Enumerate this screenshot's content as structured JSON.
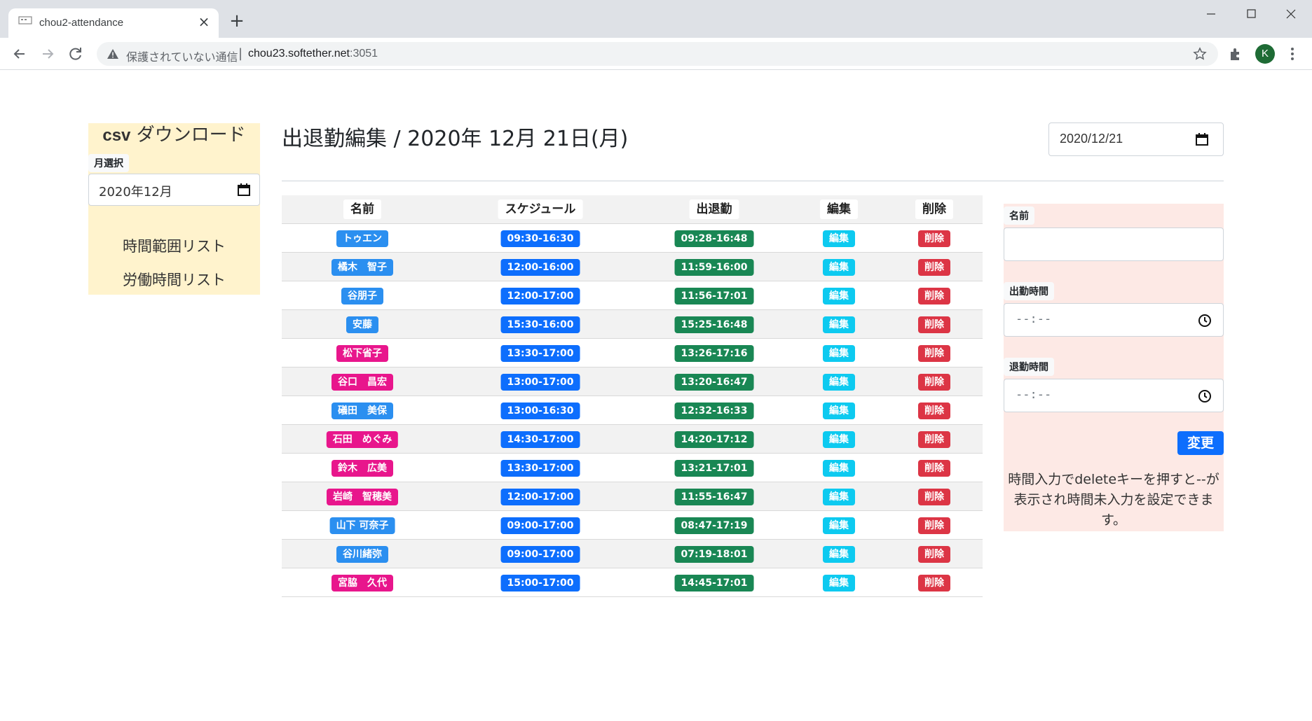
{
  "browser": {
    "tab_title": "chou2-attendance",
    "security_text": "保護されていない通信",
    "url_host": "chou23.softether.net",
    "url_port": ":3051",
    "profile_initial": "K"
  },
  "sidebar": {
    "csv_prefix": "csv",
    "csv_suffix": " ダウンロード",
    "month_label": "月選択",
    "month_value": "2020年12月",
    "links": [
      "時間範囲リスト",
      "労働時間リスト"
    ]
  },
  "main": {
    "title": "出退勤編集 / 2020年 12月 21日(月)",
    "date_value": "2020/12/21"
  },
  "table": {
    "headers": [
      "名前",
      "スケジュール",
      "出退勤",
      "編集",
      "削除"
    ],
    "edit_label": "編集",
    "delete_label": "削除",
    "rows": [
      {
        "name": "トゥエン",
        "gender": "m",
        "schedule": "09:30-16:30",
        "attendance": "09:28-16:48"
      },
      {
        "name": "橘木　智子",
        "gender": "m",
        "schedule": "12:00-16:00",
        "attendance": "11:59-16:00"
      },
      {
        "name": "谷朋子",
        "gender": "m",
        "schedule": "12:00-17:00",
        "attendance": "11:56-17:01"
      },
      {
        "name": "安藤",
        "gender": "m",
        "schedule": "15:30-16:00",
        "attendance": "15:25-16:48"
      },
      {
        "name": "松下省子",
        "gender": "f",
        "schedule": "13:30-17:00",
        "attendance": "13:26-17:16"
      },
      {
        "name": "谷口　昌宏",
        "gender": "f",
        "schedule": "13:00-17:00",
        "attendance": "13:20-16:47"
      },
      {
        "name": "礒田　美保",
        "gender": "m",
        "schedule": "13:00-16:30",
        "attendance": "12:32-16:33"
      },
      {
        "name": "石田　めぐみ",
        "gender": "f",
        "schedule": "14:30-17:00",
        "attendance": "14:20-17:12"
      },
      {
        "name": "鈴木　広美",
        "gender": "f",
        "schedule": "13:30-17:00",
        "attendance": "13:21-17:01"
      },
      {
        "name": "岩崎　智穂美",
        "gender": "f",
        "schedule": "12:00-17:00",
        "attendance": "11:55-16:47"
      },
      {
        "name": "山下 可奈子",
        "gender": "m",
        "schedule": "09:00-17:00",
        "attendance": "08:47-17:19"
      },
      {
        "name": "谷川緒弥",
        "gender": "m",
        "schedule": "09:00-17:00",
        "attendance": "07:19-18:01"
      },
      {
        "name": "宮脇　久代",
        "gender": "f",
        "schedule": "15:00-17:00",
        "attendance": "14:45-17:01"
      }
    ]
  },
  "form": {
    "name_label": "名前",
    "name_value": "",
    "start_label": "出勤時間",
    "start_value": "--:--",
    "end_label": "退勤時間",
    "end_value": "--:--",
    "submit_label": "変更",
    "help_text": "時間入力でdeleteキーを押すと--が表示され時間未入力を設定できます。"
  },
  "colors": {
    "name_blue": "#2b8ff0",
    "name_pink": "#e8168c",
    "schedule": "#0d6efd",
    "attendance": "#198754",
    "edit": "#0dcaf0",
    "delete": "#dc3545",
    "sidebar_bg": "#fff3cd",
    "form_bg": "#fde9e5"
  },
  "icons": [
    "favicon-icon",
    "close-icon",
    "plus-icon",
    "back-icon",
    "forward-icon",
    "reload-icon",
    "warning-icon",
    "star-icon",
    "puzzle-icon",
    "more-icon",
    "calendar-icon",
    "clock-icon"
  ]
}
